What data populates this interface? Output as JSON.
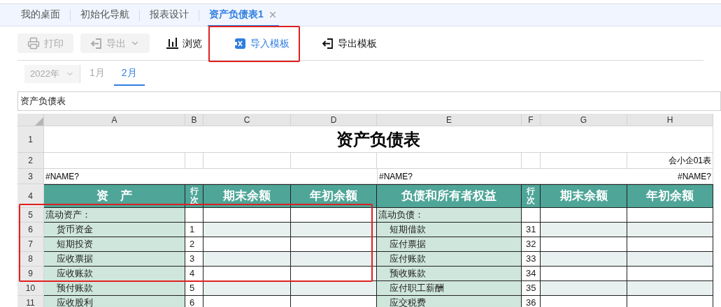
{
  "tabs": [
    {
      "label": "我的桌面",
      "selected": false,
      "closable": false
    },
    {
      "label": "初始化导航",
      "selected": false,
      "closable": false
    },
    {
      "label": "报表设计",
      "selected": false,
      "closable": false
    },
    {
      "label": "资产负债表1",
      "selected": true,
      "closable": true
    }
  ],
  "toolbar": [
    {
      "kind": "print",
      "label": "打印",
      "disabled": true,
      "dropdown": false,
      "highlighted": false
    },
    {
      "kind": "export",
      "label": "导出",
      "disabled": true,
      "dropdown": true,
      "highlighted": false
    },
    {
      "kind": "browse",
      "label": "浏览",
      "disabled": false,
      "dropdown": false,
      "highlighted": false
    },
    {
      "kind": "import",
      "label": "导入模板",
      "disabled": false,
      "dropdown": false,
      "highlighted": true
    },
    {
      "kind": "export",
      "label": "导出模板",
      "disabled": false,
      "dropdown": false,
      "highlighted": false
    }
  ],
  "period": {
    "year": {
      "value": "2022年",
      "disabled": true
    },
    "months": [
      {
        "label": "1月",
        "selected": false
      },
      {
        "label": "2月",
        "selected": true
      }
    ]
  },
  "cell_content_bar": {
    "value": "资产负债表"
  },
  "sheet": {
    "columns": [
      "A",
      "B",
      "C",
      "D",
      "E",
      "F",
      "G",
      "H"
    ],
    "rows": [
      {
        "number": "1",
        "kind": "title",
        "text": "资产负债表"
      },
      {
        "number": "2",
        "kind": "note",
        "text": "会小企01表"
      },
      {
        "number": "3",
        "kind": "info",
        "cells": [
          "#NAME?",
          "#NAME?",
          "#NAME?"
        ]
      },
      {
        "number": "4",
        "kind": "header",
        "cells": [
          "资　产",
          "行次",
          "期末余额",
          "年初余额",
          "负债和所有者权益",
          "行次",
          "期末余额",
          "年初余额"
        ]
      },
      {
        "number": "5",
        "kind": "section",
        "left": {
          "label": "流动资产："
        },
        "right": {
          "label": "流动负债："
        }
      },
      {
        "number": "6",
        "kind": "item",
        "left": {
          "label": "货币资金",
          "line": "1"
        },
        "right": {
          "label": "短期借款",
          "line": "31"
        }
      },
      {
        "number": "7",
        "kind": "item",
        "left": {
          "label": "短期投资",
          "line": "2"
        },
        "right": {
          "label": "应付票据",
          "line": "32"
        }
      },
      {
        "number": "8",
        "kind": "item",
        "left": {
          "label": "应收票据",
          "line": "3"
        },
        "right": {
          "label": "应付账款",
          "line": "33"
        }
      },
      {
        "number": "9",
        "kind": "item",
        "left": {
          "label": "应收账款",
          "line": "4"
        },
        "right": {
          "label": "预收账款",
          "line": "34"
        }
      },
      {
        "number": "10",
        "kind": "item",
        "left": {
          "label": "预付账款",
          "line": "5"
        },
        "right": {
          "label": "应付职工薪酬",
          "line": "35"
        }
      },
      {
        "number": "11",
        "kind": "item",
        "left": {
          "label": "应收股利",
          "line": "6"
        },
        "right": {
          "label": "应交税费",
          "line": "36"
        }
      }
    ]
  }
}
